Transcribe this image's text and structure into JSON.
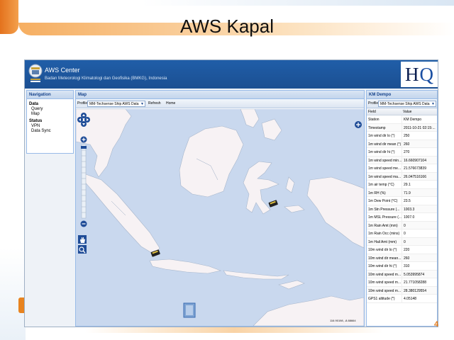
{
  "slide": {
    "title": "AWS Kapal"
  },
  "app": {
    "title": "AWS Center",
    "subtitle": "Badan Meteorologi Klimatologi dan Geofisika (BMKG), Indonesia",
    "logo_text": "HQ"
  },
  "navigation": {
    "title": "Navigation",
    "groups": [
      {
        "label": "Data",
        "items": [
          "Query",
          "Map"
        ]
      },
      {
        "label": "Status",
        "items": [
          "VPN",
          "Data Sync"
        ]
      }
    ]
  },
  "map_panel": {
    "title": "Map",
    "toolbar": {
      "profile_label": "Profile:",
      "profile_value": "MM-Techsense Ship AWS Data",
      "refresh_label": "Refresh",
      "home_label": "Home"
    },
    "coordinates": "116.90198, -8.88664"
  },
  "side_panel": {
    "title": "KM Dempo",
    "profile_label": "Profile:",
    "profile_value": "MM-Techsense Ship AWS Data",
    "columns": {
      "field": "Field",
      "value": "Value"
    },
    "rows": [
      {
        "field": "Station",
        "value": "KM Dempo"
      },
      {
        "field": "Timestamp",
        "value": "2011-10-21 02:15:..."
      },
      {
        "field": "1m wind dir lo (°)",
        "value": "250"
      },
      {
        "field": "1m wind dir mean (°)",
        "value": "260"
      },
      {
        "field": "1m wind dir hi (°)",
        "value": "270"
      },
      {
        "field": "1m wind speed min...",
        "value": "16.660907104"
      },
      {
        "field": "1m wind speed me...",
        "value": "21.576673839"
      },
      {
        "field": "1m wind speed ma...",
        "value": "26.047516166"
      },
      {
        "field": "1m air temp (°C)",
        "value": "29.1"
      },
      {
        "field": "1m RH (%)",
        "value": "71.9"
      },
      {
        "field": "1m Dew Point (°C)",
        "value": "23.5"
      },
      {
        "field": "1m Stn Pressure (...",
        "value": "1003.3"
      },
      {
        "field": "1m MSL Pressure (...",
        "value": "1007.0"
      },
      {
        "field": "1m Rain Amt (mm)",
        "value": "0"
      },
      {
        "field": "1m Rain Occ (mins)",
        "value": "0"
      },
      {
        "field": "1m Hail Amt (mm)",
        "value": "0"
      },
      {
        "field": "10m wind dir lo (°)",
        "value": "220"
      },
      {
        "field": "10m wind dir mean...",
        "value": "260"
      },
      {
        "field": "10m wind dir hi (°)",
        "value": "310"
      },
      {
        "field": "10m wind speed m...",
        "value": "5.053995874"
      },
      {
        "field": "10m wind speed m...",
        "value": "21.771058288"
      },
      {
        "field": "10m wind speed m...",
        "value": "28.380129554"
      },
      {
        "field": "GPS1 altitude (*)",
        "value": "4.05148"
      }
    ]
  },
  "colors": {
    "header": "#1b4f92",
    "sea": "#c9d8ee",
    "land": "#f7f2f4",
    "accent_orange": "#e57c1c"
  }
}
